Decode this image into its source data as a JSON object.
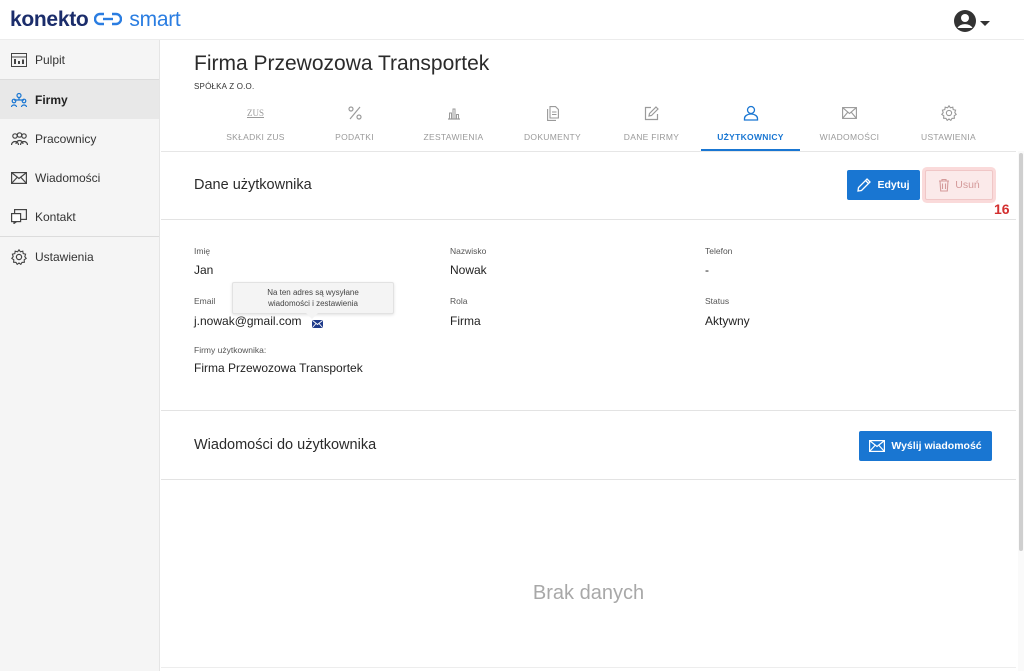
{
  "brand": {
    "part1": "konekto",
    "part2": "smart"
  },
  "sidebar": {
    "items": [
      {
        "label": "Pulpit",
        "icon": "dashboard-icon"
      },
      {
        "label": "Firmy",
        "icon": "companies-icon"
      },
      {
        "label": "Pracownicy",
        "icon": "employees-icon"
      },
      {
        "label": "Wiadomości",
        "icon": "mail-icon"
      },
      {
        "label": "Kontakt",
        "icon": "contact-icon"
      },
      {
        "label": "Ustawienia",
        "icon": "gear-icon"
      }
    ],
    "active": "Firmy"
  },
  "company": {
    "name": "Firma Przewozowa Transportek",
    "type": "SPÓŁKA Z O.O."
  },
  "tabs": [
    {
      "label": "SKŁADKI ZUS",
      "icon": "zus-icon",
      "icon_text": "ZUS"
    },
    {
      "label": "PODATKI",
      "icon": "percent-icon"
    },
    {
      "label": "ZESTAWIENIA",
      "icon": "bar-chart-icon"
    },
    {
      "label": "DOKUMENTY",
      "icon": "documents-icon"
    },
    {
      "label": "DANE FIRMY",
      "icon": "edit-icon"
    },
    {
      "label": "UŻYTKOWNICY",
      "icon": "user-icon"
    },
    {
      "label": "WIADOMOŚCI",
      "icon": "mail-icon"
    },
    {
      "label": "USTAWIENIA",
      "icon": "gear-icon"
    }
  ],
  "active_tab": "UŻYTKOWNICY",
  "user_section": {
    "title": "Dane użytkownika",
    "edit_label": "Edytuj",
    "delete_label": "Usuń",
    "annotation": "16"
  },
  "user": {
    "first_name_label": "Imię",
    "first_name": "Jan",
    "last_name_label": "Nazwisko",
    "last_name": "Nowak",
    "phone_label": "Telefon",
    "phone": "-",
    "email_label": "Email",
    "email": "j.nowak@gmail.com",
    "email_tooltip_line1": "Na ten adres są wysyłane",
    "email_tooltip_line2": "wiadomości i zestawienia",
    "role_label": "Rola",
    "role": "Firma",
    "status_label": "Status",
    "status": "Aktywny",
    "companies_label": "Firmy użytkownika:",
    "companies": "Firma Przewozowa Transportek"
  },
  "messages_section": {
    "title": "Wiadomości do użytkownika",
    "send_label": "Wyślij wiadomość",
    "empty_text": "Brak danych"
  },
  "colors": {
    "primary": "#1976d2",
    "brand_dark": "#1b2d6b",
    "brand_light": "#2a7de1",
    "danger_badge": "#d32f2f"
  }
}
